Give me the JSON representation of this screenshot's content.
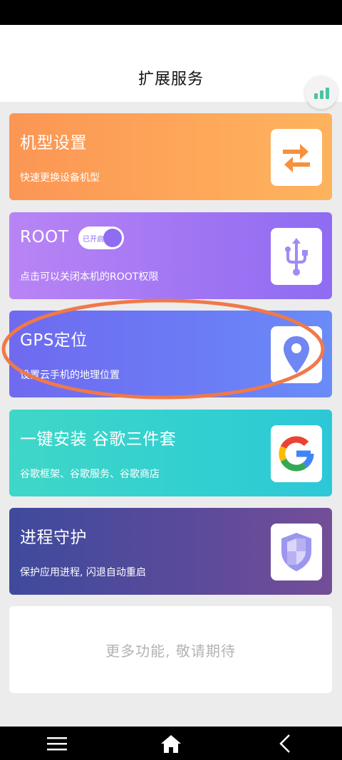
{
  "header": {
    "title": "扩展服务"
  },
  "icons": {
    "signal": "signal-bars-icon"
  },
  "cards": [
    {
      "title": "机型设置",
      "subtitle": "快速更换设备机型",
      "icon": "swap-arrows-icon",
      "color": "#fb9654"
    },
    {
      "title": "ROOT",
      "subtitle": "点击可以关闭本机的ROOT权限",
      "icon": "usb-icon",
      "color": "#9f74f3",
      "toggle": {
        "label": "已开启",
        "state": true
      }
    },
    {
      "title": "GPS定位",
      "subtitle": "设置云手机的地理位置",
      "icon": "location-pin-icon",
      "color": "#6b7cf5"
    },
    {
      "title": "一键安装 谷歌三件套",
      "subtitle": "谷歌框架、谷歌服务、谷歌商店",
      "icon": "google-icon",
      "color": "#32cfd1"
    },
    {
      "title": "进程守护",
      "subtitle": "保护应用进程, 闪退自动重启",
      "icon": "shield-icon",
      "color": "#5a4a9b"
    }
  ],
  "more": {
    "label": "更多功能, 敬请期待"
  },
  "nav": {
    "menu": "menu-icon",
    "home": "home-icon",
    "back": "back-icon"
  },
  "annotation": {
    "color": "#f0794a"
  }
}
